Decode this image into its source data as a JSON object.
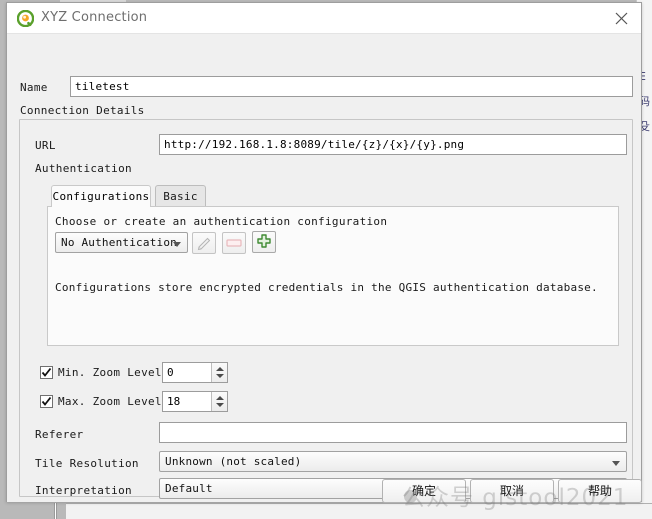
{
  "window": {
    "title": "XYZ Connection",
    "icon": "qgis-logo-icon",
    "close_icon": "close-icon"
  },
  "form": {
    "name_label": "Name",
    "name_value": "tiletest",
    "name_placeholder": "",
    "group_title": "Connection Details",
    "url_label": "URL",
    "url_value": "http://192.168.1.8:8089/tile/{z}/{x}/{y}.png",
    "url_placeholder": "",
    "authentication_label": "Authentication"
  },
  "auth": {
    "tabs": [
      {
        "label": "Configurations",
        "active": true
      },
      {
        "label": "Basic",
        "active": false
      }
    ],
    "prompt": "Choose or create an authentication configuration",
    "config_selected": "No Authentication",
    "edit_icon": "pencil-edit-icon",
    "remove_icon": "minus-remove-icon",
    "add_icon": "plus-add-icon",
    "note": "Configurations store encrypted credentials in the QGIS authentication database."
  },
  "zoom_levels": {
    "min_label": "Min. Zoom Level",
    "min_checked": true,
    "min_value": "0",
    "max_label": "Max. Zoom Level",
    "max_checked": true,
    "max_value": "18"
  },
  "options": {
    "referer_label": "Referer",
    "referer_value": "",
    "referer_placeholder": "",
    "tile_resolution_label": "Tile Resolution",
    "tile_resolution_value": "Unknown (not scaled)",
    "interpretation_label": "Interpretation",
    "interpretation_value": "Default"
  },
  "buttons": {
    "ok": "确定",
    "cancel": "取消",
    "help": "帮助"
  },
  "watermark": {
    "text": "公众号 gistool2021"
  },
  "background": {
    "edge_chars": [
      "E",
      "码",
      "殳"
    ]
  },
  "colors": {
    "accent_green": "#4e9a3e",
    "accent_orange": "#f0a030",
    "dialog_bg": "#f0f0f0",
    "field_bg": "#ffffff",
    "title_text": "#6e6e6e"
  }
}
